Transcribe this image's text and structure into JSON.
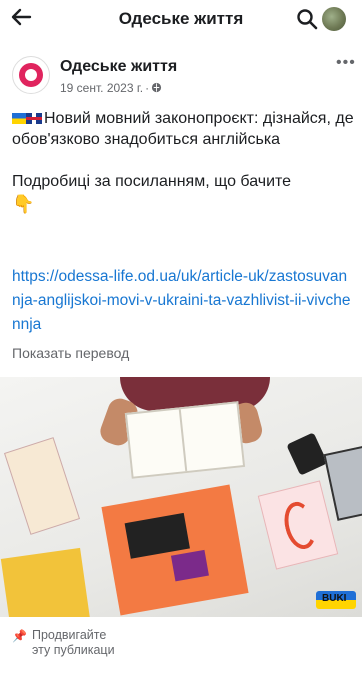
{
  "header": {
    "title": "Одеське життя",
    "back_icon": "arrow-left-icon",
    "search_icon": "search-icon",
    "avatar": "profile-avatar"
  },
  "post": {
    "page_name": "Одеське життя",
    "date": "19 сент. 2023 г.",
    "audience_icon": "globe-icon",
    "more_icon": "more-horizontal-icon",
    "text_line1": "Новий мовний законопроєкт: дізнайся, де обов'язково знадобиться англійська",
    "text_line2": "Подробиці за посиланням, що бачите",
    "point_icon": "pointing-down-emoji",
    "link": "https://odessa-life.od.ua/uk/article-uk/zastosuvannja-anglijskoi-movi-v-ukraini-ta-vazhlivist-ii-vivchennja",
    "translate_label": "Показать перевод",
    "image_brand": "BUKI",
    "promote_label": "Продвигайте эту публикаци"
  }
}
